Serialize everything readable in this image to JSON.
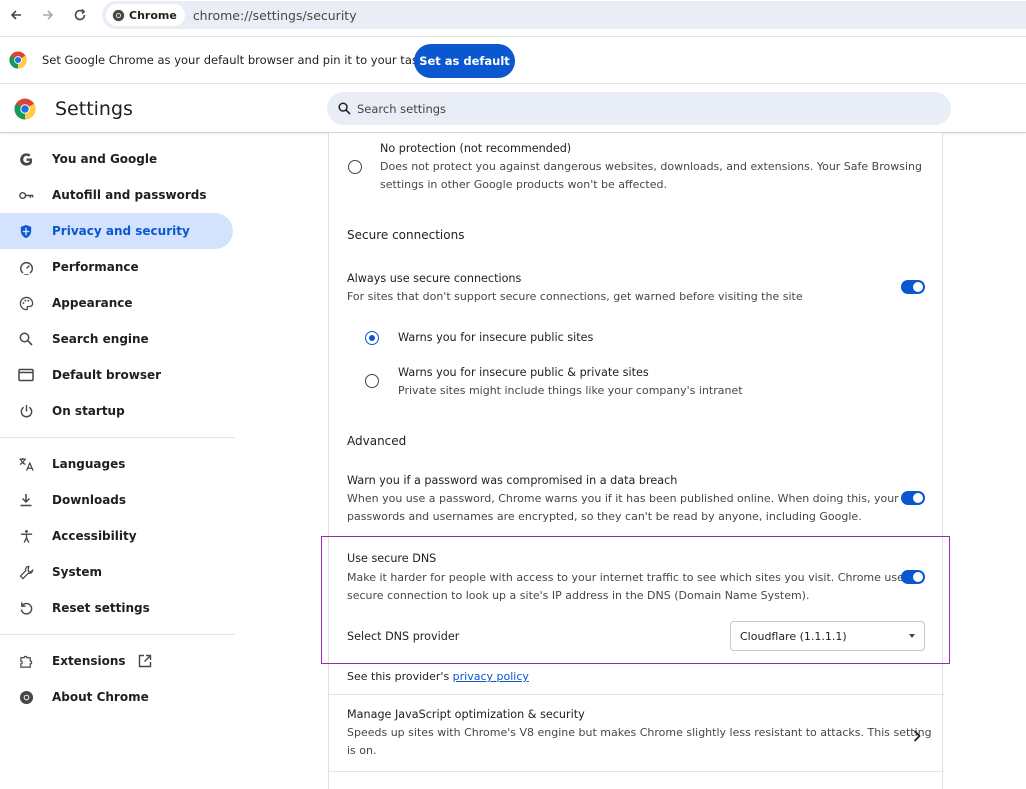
{
  "browser": {
    "chip_label": "Chrome",
    "url": "chrome://settings/security"
  },
  "banner": {
    "text": "Set Google Chrome as your default browser and pin it to your taskbar",
    "button": "Set as default"
  },
  "header": {
    "title": "Settings",
    "search_placeholder": "Search settings"
  },
  "sidebar": {
    "items": [
      {
        "label": "You and Google",
        "icon": "google-icon"
      },
      {
        "label": "Autofill and passwords",
        "icon": "key-icon"
      },
      {
        "label": "Privacy and security",
        "icon": "shield-icon",
        "active": true
      },
      {
        "label": "Performance",
        "icon": "speedometer-icon"
      },
      {
        "label": "Appearance",
        "icon": "palette-icon"
      },
      {
        "label": "Search engine",
        "icon": "search-icon"
      },
      {
        "label": "Default browser",
        "icon": "browser-window-icon"
      },
      {
        "label": "On startup",
        "icon": "power-icon"
      },
      {
        "label": "Languages",
        "icon": "translate-icon"
      },
      {
        "label": "Downloads",
        "icon": "download-icon"
      },
      {
        "label": "Accessibility",
        "icon": "accessibility-icon"
      },
      {
        "label": "System",
        "icon": "wrench-icon"
      },
      {
        "label": "Reset settings",
        "icon": "reset-icon"
      },
      {
        "label": "Extensions",
        "icon": "puzzle-icon"
      },
      {
        "label": "About Chrome",
        "icon": "chrome-icon"
      }
    ]
  },
  "main": {
    "no_protection": {
      "title": "No protection (not recommended)",
      "desc1": "Does not protect you against dangerous websites, downloads, and extensions. Your Safe Browsing",
      "desc2": "settings in other Google products won't be affected."
    },
    "secure_connections": {
      "heading": "Secure connections",
      "always_title": "Always use secure connections",
      "always_desc": "For sites that don't support secure connections, get warned before visiting the site",
      "always_enabled": true,
      "option_public": "Warns you for insecure public sites",
      "option_private_title": "Warns you for insecure public & private sites",
      "option_private_desc": "Private sites might include things like your company's intranet"
    },
    "advanced": {
      "heading": "Advanced",
      "warn_title": "Warn you if a password was compromised in a data breach",
      "warn_desc1": "When you use a password, Chrome warns you if it has been published online. When doing this, your",
      "warn_desc2": "passwords and usernames are encrypted, so they can't be read by anyone, including Google.",
      "warn_enabled": true,
      "dns_title": "Use secure DNS",
      "dns_desc1": "Make it harder for people with access to your internet traffic to see which sites you visit. Chrome uses a",
      "dns_desc2": "secure connection to look up a site's IP address in the DNS (Domain Name System).",
      "dns_enabled": true,
      "dns_provider_label": "Select DNS provider",
      "dns_provider_value": "Cloudflare (1.1.1.1)",
      "privacy_prefix": "See this provider's",
      "privacy_link": "privacy policy",
      "js_title": "Manage JavaScript optimization & security",
      "js_desc1": "Speeds up sites with Chrome's V8 engine but makes Chrome slightly less resistant to attacks. This setting",
      "js_desc2": "is on."
    }
  }
}
